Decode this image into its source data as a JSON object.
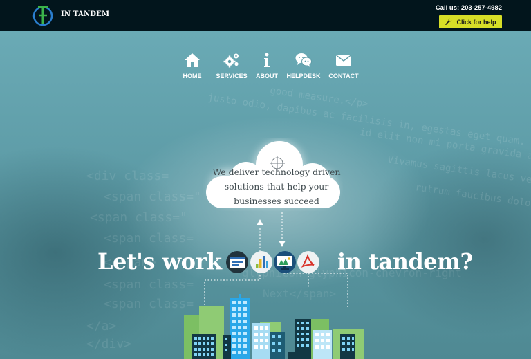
{
  "header": {
    "brand": "IN TANDEM",
    "phone": "Call us: 203-257-4982",
    "help_label": "Click for help",
    "colors": {
      "bar": "#02151c",
      "help_button": "#d7de27"
    }
  },
  "nav": {
    "items": [
      {
        "label": "HOME",
        "icon": "home-icon"
      },
      {
        "label": "SERVICES",
        "icon": "gears-icon"
      },
      {
        "label": "ABOUT",
        "icon": "info-icon"
      },
      {
        "label": "HELPDESK",
        "icon": "chat-icon"
      },
      {
        "label": "CONTACT",
        "icon": "envelope-icon"
      }
    ]
  },
  "hero": {
    "cloud_line1": "We deliver technology driven",
    "cloud_line2": "solutions that help your",
    "cloud_line3": "businesses succeed",
    "headline_left": "Let's work",
    "headline_right": "in tandem?",
    "badges": [
      "browser-icon",
      "bar-chart-icon",
      "monitor-icon",
      "pdf-icon"
    ]
  }
}
